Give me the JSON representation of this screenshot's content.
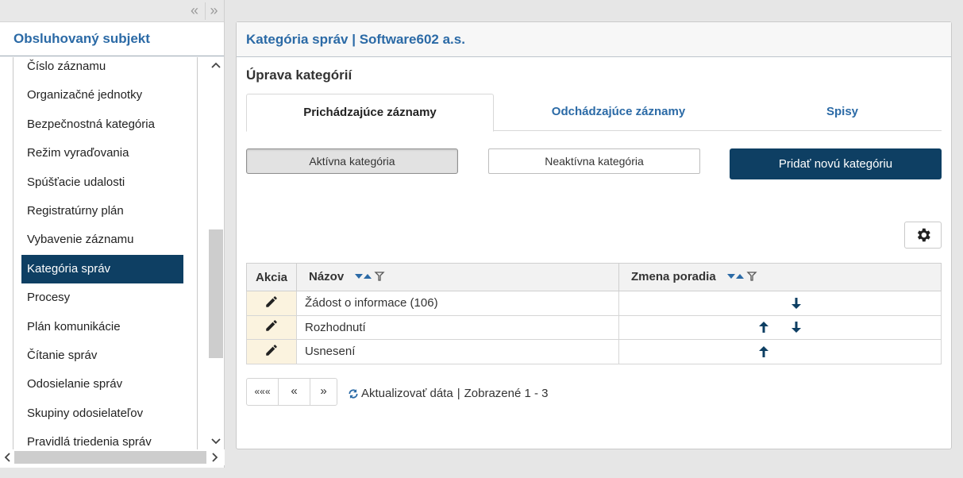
{
  "sidebar": {
    "title": "Obsluhovaný subjekt",
    "collapse_left": "«",
    "collapse_right": "»",
    "items": [
      {
        "label": "Číslo záznamu"
      },
      {
        "label": "Organizačné jednotky"
      },
      {
        "label": "Bezpečnostná kategória"
      },
      {
        "label": "Režim vyraďovania"
      },
      {
        "label": "Spúšťacie udalosti"
      },
      {
        "label": "Registratúrny plán"
      },
      {
        "label": "Vybavenie záznamu"
      },
      {
        "label": "Kategória správ",
        "active": true
      },
      {
        "label": "Procesy"
      },
      {
        "label": "Plán komunikácie"
      },
      {
        "label": "Čítanie správ"
      },
      {
        "label": "Odosielanie správ"
      },
      {
        "label": "Skupiny odosielateľov"
      },
      {
        "label": "Pravidlá triedenia správ"
      }
    ]
  },
  "panel": {
    "header": "Kategória správ | Software602 a.s.",
    "section_title": "Úprava kategórií",
    "tabs": [
      {
        "label": "Prichádzajúce záznamy",
        "active": true
      },
      {
        "label": "Odchádzajúce záznamy"
      },
      {
        "label": "Spisy"
      }
    ],
    "buttons": {
      "active_category": "Aktívna kategória",
      "inactive_category": "Neaktívna kategória",
      "add_category": "Pridať novú kategóriu"
    }
  },
  "table": {
    "columns": {
      "action": "Akcia",
      "name": "Názov",
      "order": "Zmena poradia"
    },
    "rows": [
      {
        "name": "Žádost o informace (106)",
        "up": false,
        "down": true
      },
      {
        "name": "Rozhodnutí",
        "up": true,
        "down": true
      },
      {
        "name": "Usnesení",
        "up": true,
        "down": false
      }
    ]
  },
  "pager": {
    "first": "«««",
    "prev": "«",
    "next": "»",
    "refresh_label": "Aktualizovať dáta",
    "separator": "|",
    "range": "Zobrazené 1 - 3"
  },
  "colors": {
    "accent": "#2b6aa6",
    "primary": "#0e3f63",
    "edit_bg": "#fbf3df"
  }
}
